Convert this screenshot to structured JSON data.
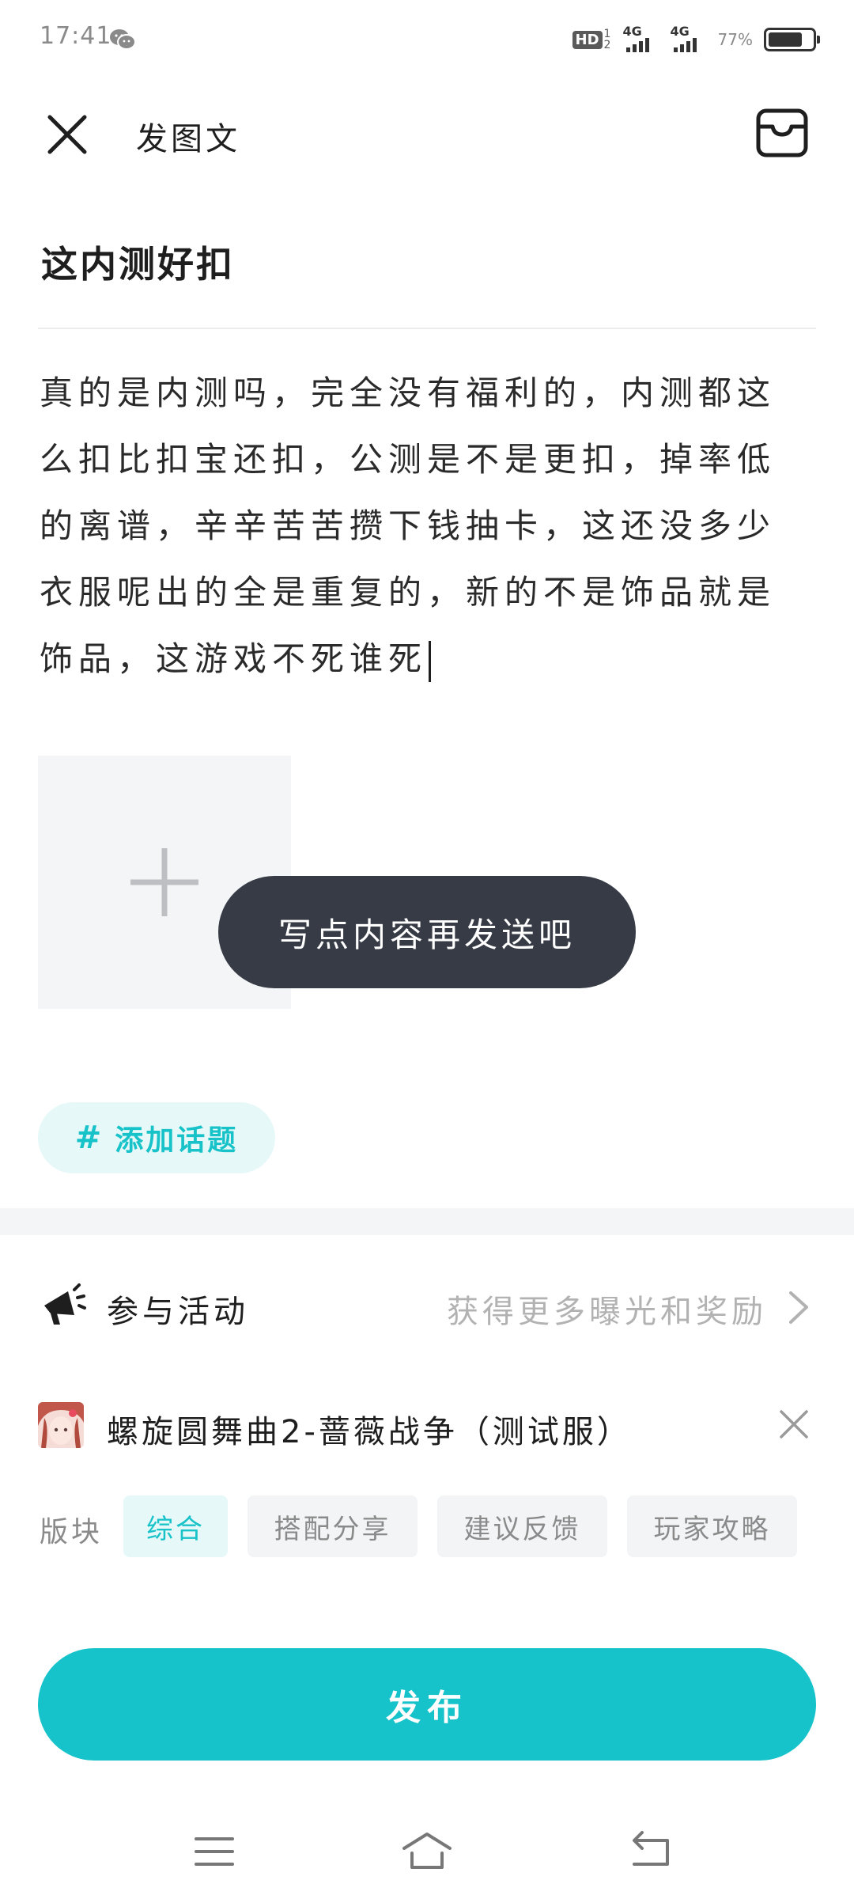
{
  "status_bar": {
    "time": "17:41",
    "hd_label": "HD",
    "hd_sub": "1 2",
    "signal_1": "4G",
    "signal_2": "4G",
    "battery_percent": "77%",
    "battery_level": 0.77,
    "icons": [
      "wechat-icon",
      "signal-icon",
      "battery-icon"
    ]
  },
  "header": {
    "title": "发图文",
    "close_icon": "close-icon",
    "drafts_icon": "drafts-box-icon"
  },
  "post": {
    "title": "这内测好扣",
    "body": "真的是内测吗，完全没有福利的，内测都这么扣比扣宝还扣，公测是不是更扣，掉率低的离谱，辛辛苦苦攒下钱抽卡，这还没多少衣服呢出的全是重复的，新的不是饰品就是饰品，这游戏不死谁死"
  },
  "add_image": {
    "icon": "plus-icon"
  },
  "toast": {
    "text": "写点内容再发送吧"
  },
  "topic": {
    "hash": "#",
    "label": "添加话题"
  },
  "activity": {
    "label": "参与活动",
    "hint": "获得更多曝光和奖励",
    "icon": "megaphone-icon"
  },
  "game": {
    "name": "螺旋圆舞曲2-蔷薇战争（测试服）",
    "avatar_icon": "game-avatar",
    "remove_icon": "close-icon"
  },
  "sections": {
    "label": "版块",
    "items": [
      {
        "label": "综合",
        "active": true
      },
      {
        "label": "搭配分享",
        "active": false
      },
      {
        "label": "建议反馈",
        "active": false
      },
      {
        "label": "玩家攻略",
        "active": false
      }
    ]
  },
  "publish": {
    "label": "发布"
  },
  "colors": {
    "accent": "#17c3ca",
    "accent_light": "#e6f8f8",
    "toast_bg": "#363b45",
    "hint_text": "#b2b2b2"
  },
  "nav": {
    "icons": [
      "menu-icon",
      "home-icon",
      "back-icon"
    ]
  }
}
